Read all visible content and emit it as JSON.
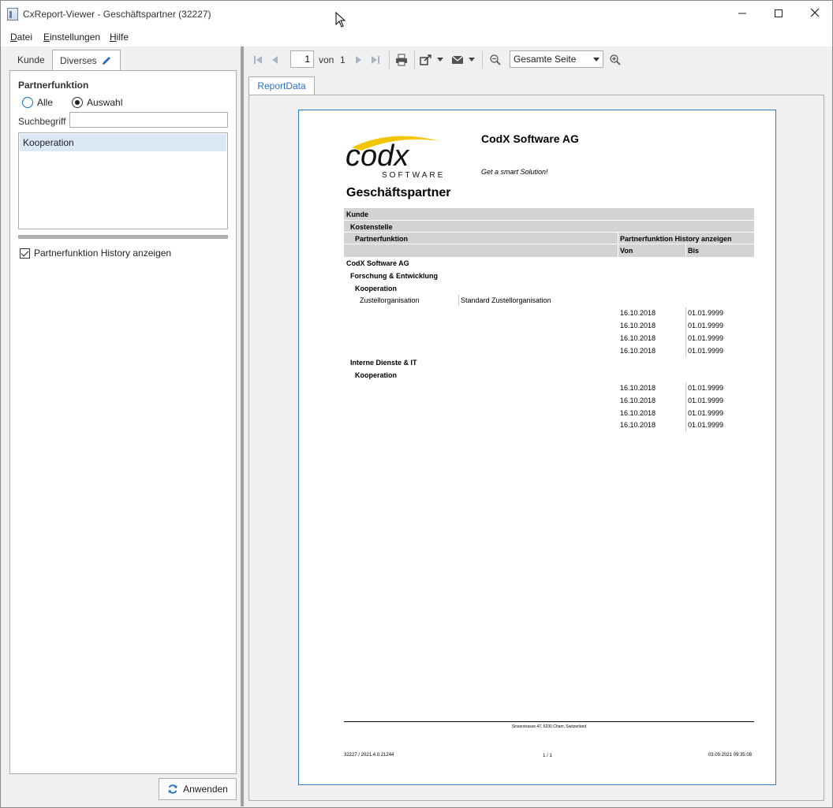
{
  "window": {
    "title": "CxReport-Viewer - Geschäftspartner (32227)",
    "controls": {
      "minimize": "—",
      "maximize": "☐",
      "close": "✕"
    }
  },
  "menu": {
    "items": [
      {
        "first": "D",
        "rest": "atei"
      },
      {
        "first": "E",
        "rest": "instellungen"
      },
      {
        "first": "H",
        "rest": "ilfe"
      }
    ]
  },
  "left": {
    "tabs": [
      "Kunde",
      "Diverses"
    ],
    "section_title": "Partnerfunktion",
    "radio_all": "Alle",
    "radio_selection": "Auswahl",
    "radio_selected": "Auswahl",
    "search_label": "Suchbegriff",
    "search_value": "",
    "list_items": [
      "Kooperation"
    ],
    "checkbox_label": "Partnerfunktion History anzeigen",
    "checkbox_checked": true,
    "apply_label": "Anwenden"
  },
  "toolbar": {
    "page_current": "1",
    "page_of": "von",
    "page_total": "1",
    "zoom_value": "Gesamte Seite"
  },
  "report": {
    "tab_label": "ReportData",
    "company": "CodX Software AG",
    "slogan": "Get a smart Solution!",
    "logo_text": "codx",
    "logo_sub": "SOFTWARE",
    "title": "Geschäftspartner",
    "headers": {
      "kunde": "Kunde",
      "kostenstelle": "Kostenstelle",
      "partnerfunktion": "Partnerfunktion",
      "history": "Partnerfunktion History anzeigen",
      "von": "Von",
      "bis": "Bis"
    },
    "customer": "CodX Software AG",
    "groups": [
      {
        "name": "Forschung & Entwicklung",
        "function": "Kooperation",
        "detail_label": "Zustellorganisation",
        "detail_value": "Standard Zustellorganisation",
        "rows": [
          {
            "von": "16.10.2018",
            "bis": "01.01.9999"
          },
          {
            "von": "16.10.2018",
            "bis": "01.01.9999"
          },
          {
            "von": "16.10.2018",
            "bis": "01.01.9999"
          },
          {
            "von": "16.10.2018",
            "bis": "01.01.9999"
          }
        ]
      },
      {
        "name": "Interne Dienste & IT",
        "function": "Kooperation",
        "rows": [
          {
            "von": "16.10.2018",
            "bis": "01.01.9999"
          },
          {
            "von": "16.10.2018",
            "bis": "01.01.9999"
          },
          {
            "von": "16.10.2018",
            "bis": "01.01.9999"
          },
          {
            "von": "16.10.2018",
            "bis": "01.01.9999"
          }
        ]
      }
    ],
    "footer_address": "Sinserstrasse 47, 6330 Cham, Switzerland",
    "footer_left": "32227 / 2021.4.0.21244",
    "footer_page": "1 / 1",
    "footer_date": "03.09.2021 09:35:08"
  }
}
